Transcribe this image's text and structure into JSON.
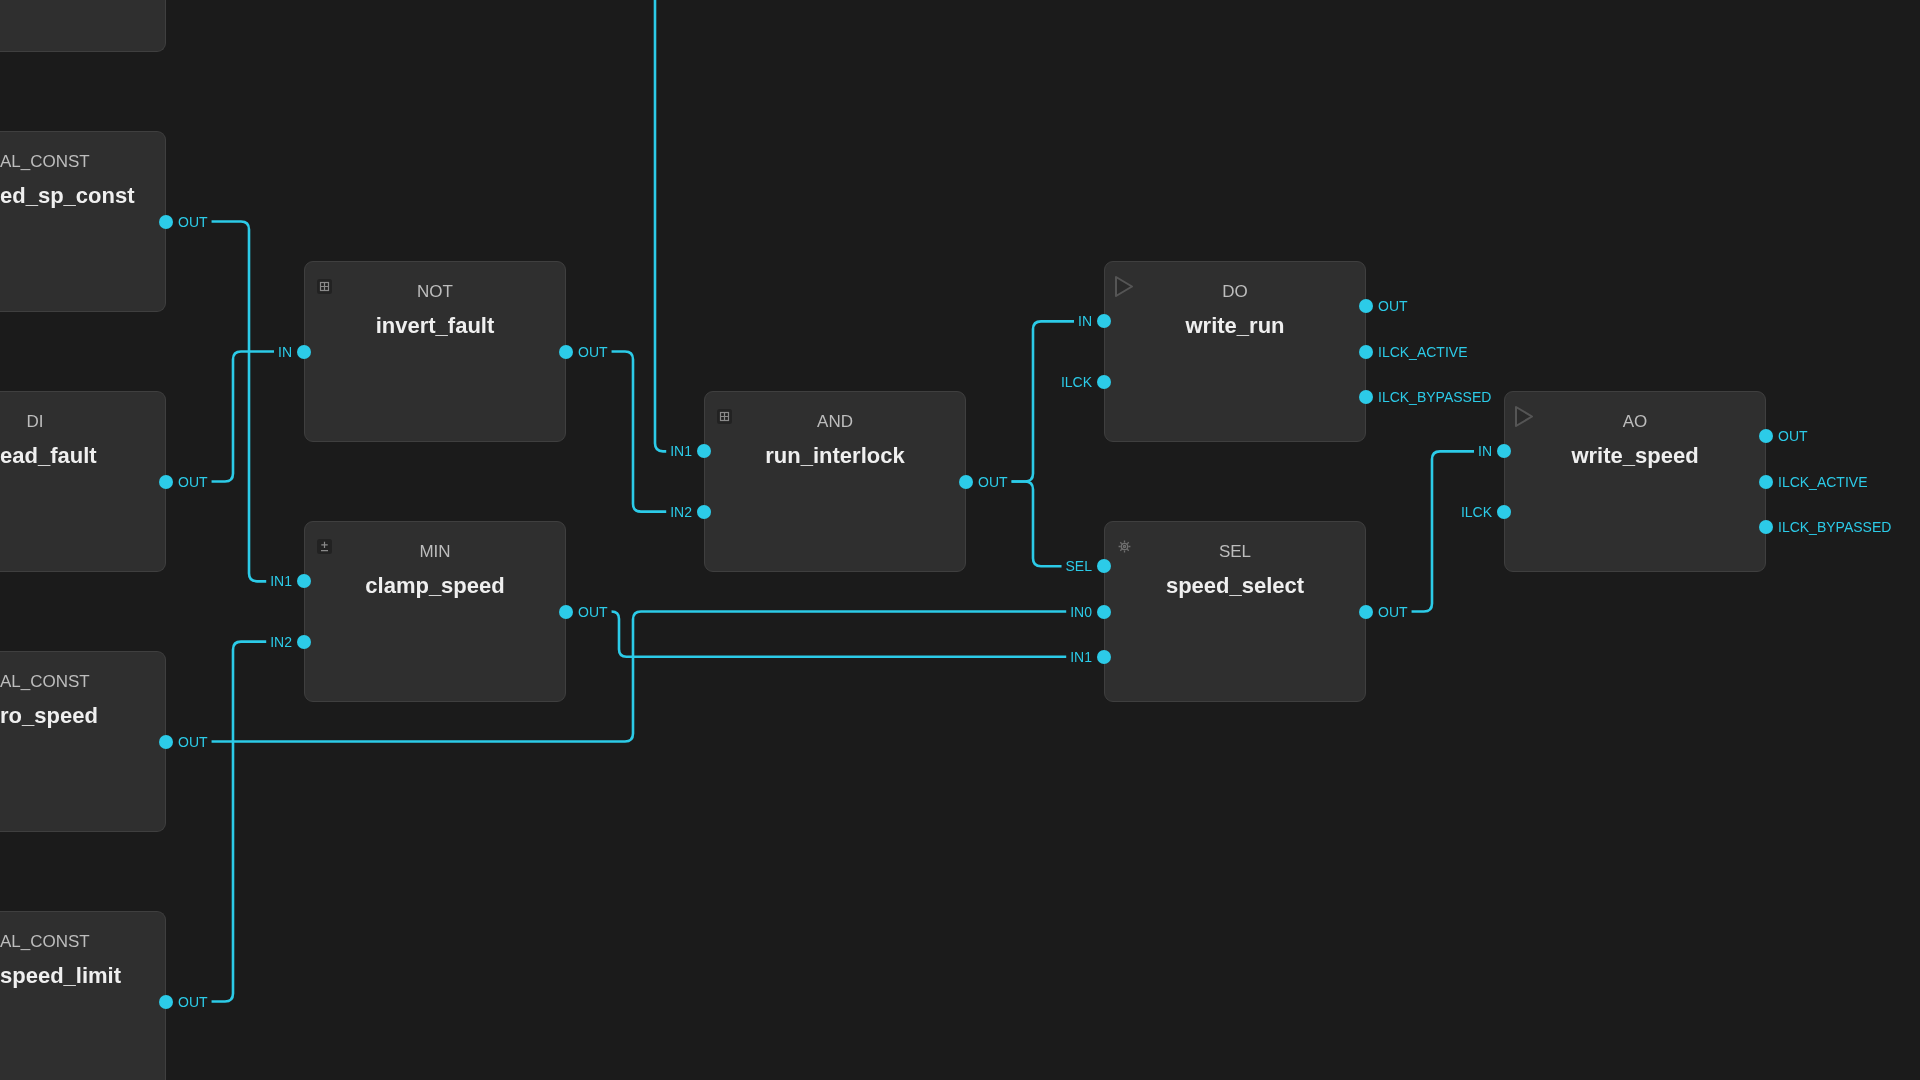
{
  "canvas": {
    "nodes": [
      {
        "kind": "block"
      },
      {
        "kind": "const",
        "type": "AL_CONST",
        "name": "ed_sp_const",
        "outputs": [
          {
            "label": "OUT"
          }
        ]
      },
      {
        "kind": "input",
        "type": "DI",
        "name": "ead_fault",
        "outputs": [
          {
            "label": "OUT"
          }
        ]
      },
      {
        "kind": "const",
        "type": "AL_CONST",
        "name": "ro_speed",
        "outputs": [
          {
            "label": "OUT"
          }
        ]
      },
      {
        "kind": "const",
        "type": "AL_CONST",
        "name": "speed_limit",
        "outputs": [
          {
            "label": "OUT"
          }
        ]
      },
      {
        "kind": "logic",
        "type": "NOT",
        "name": "invert_fault",
        "inputs": [
          {
            "label": "IN",
            "wired": true
          }
        ],
        "outputs": [
          {
            "label": "OUT"
          }
        ]
      },
      {
        "kind": "math",
        "type": "MIN",
        "name": "clamp_speed",
        "inputs": [
          {
            "label": "IN1",
            "wired": true
          },
          {
            "label": "IN2",
            "wired": true
          }
        ],
        "outputs": [
          {
            "label": "OUT"
          }
        ]
      },
      {
        "kind": "logic",
        "type": "AND",
        "name": "run_interlock",
        "inputs": [
          {
            "label": "IN1",
            "wired": true
          },
          {
            "label": "IN2",
            "wired": true
          }
        ],
        "outputs": [
          {
            "label": "OUT"
          }
        ]
      },
      {
        "kind": "output",
        "type": "DO",
        "name": "write_run",
        "inputs": [
          {
            "label": "IN",
            "wired": true
          },
          {
            "label": "ILCK",
            "wired": false
          }
        ],
        "outputs": [
          {
            "label": "OUT"
          },
          {
            "label": "ILCK_ACTIVE"
          },
          {
            "label": "ILCK_BYPASSED"
          }
        ]
      },
      {
        "kind": "selector",
        "type": "SEL",
        "name": "speed_select",
        "inputs": [
          {
            "label": "SEL",
            "wired": true
          },
          {
            "label": "IN0",
            "wired": true
          },
          {
            "label": "IN1",
            "wired": true
          }
        ],
        "outputs": [
          {
            "label": "OUT"
          }
        ]
      },
      {
        "kind": "output",
        "type": "AO",
        "name": "write_speed",
        "inputs": [
          {
            "label": "IN",
            "wired": true
          },
          {
            "label": "ILCK",
            "wired": false
          }
        ],
        "outputs": [
          {
            "label": "OUT"
          },
          {
            "label": "ILCK_ACTIVE"
          },
          {
            "label": "ILCK_BYPASSED"
          }
        ]
      }
    ]
  }
}
